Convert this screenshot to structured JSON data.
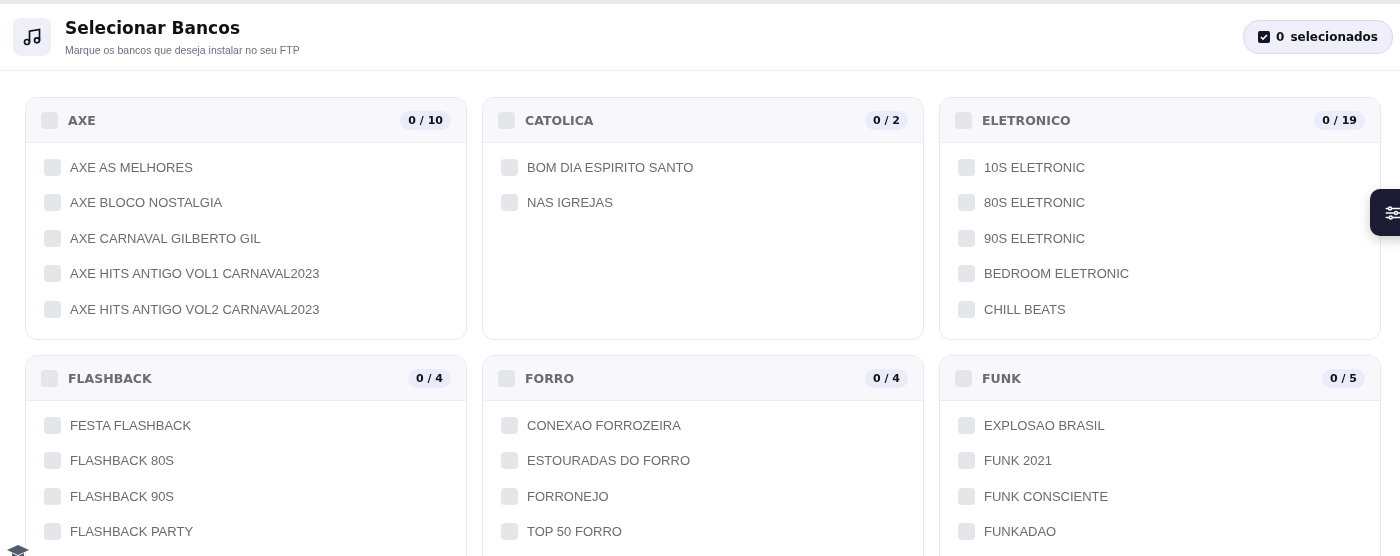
{
  "header": {
    "title": "Selecionar Bancos",
    "subtitle": "Marque os bancos que deseja instalar no seu FTP",
    "selected_count": {
      "value": "0",
      "label": "selecionados"
    }
  },
  "groups": [
    {
      "name": "AXE",
      "checked": false,
      "count": "0 / 10",
      "items": [
        {
          "label": "AXE AS MELHORES",
          "checked": false
        },
        {
          "label": "AXE BLOCO NOSTALGIA",
          "checked": false
        },
        {
          "label": "AXE CARNAVAL GILBERTO GIL",
          "checked": false
        },
        {
          "label": "AXE HITS ANTIGO VOL1 CARNAVAL2023",
          "checked": false
        },
        {
          "label": "AXE HITS ANTIGO VOL2 CARNAVAL2023",
          "checked": false
        }
      ]
    },
    {
      "name": "CATOLICA",
      "checked": false,
      "count": "0 / 2",
      "items": [
        {
          "label": "BOM DIA ESPIRITO SANTO",
          "checked": false
        },
        {
          "label": "NAS IGREJAS",
          "checked": false
        }
      ]
    },
    {
      "name": "ELETRONICO",
      "checked": false,
      "count": "0 / 19",
      "items": [
        {
          "label": "10S ELETRONIC",
          "checked": false
        },
        {
          "label": "80S ELETRONIC",
          "checked": false
        },
        {
          "label": "90S ELETRONIC",
          "checked": false
        },
        {
          "label": "BEDROOM ELETRONIC",
          "checked": false
        },
        {
          "label": "CHILL BEATS",
          "checked": false
        }
      ]
    },
    {
      "name": "FLASHBACK",
      "checked": false,
      "count": "0 / 4",
      "items": [
        {
          "label": "FESTA FLASHBACK",
          "checked": false
        },
        {
          "label": "FLASHBACK 80S",
          "checked": false
        },
        {
          "label": "FLASHBACK 90S",
          "checked": false
        },
        {
          "label": "FLASHBACK PARTY",
          "checked": false
        }
      ]
    },
    {
      "name": "FORRO",
      "checked": false,
      "count": "0 / 4",
      "items": [
        {
          "label": "CONEXAO FORROZEIRA",
          "checked": false
        },
        {
          "label": "ESTOURADAS DO FORRO",
          "checked": false
        },
        {
          "label": "FORRONEJO",
          "checked": false
        },
        {
          "label": "TOP 50 FORRO",
          "checked": false
        }
      ]
    },
    {
      "name": "FUNK",
      "checked": false,
      "count": "0 / 5",
      "items": [
        {
          "label": "EXPLOSAO BRASIL",
          "checked": false
        },
        {
          "label": "FUNK 2021",
          "checked": false
        },
        {
          "label": "FUNK CONSCIENTE",
          "checked": false
        },
        {
          "label": "FUNKADAO",
          "checked": false
        }
      ]
    }
  ]
}
